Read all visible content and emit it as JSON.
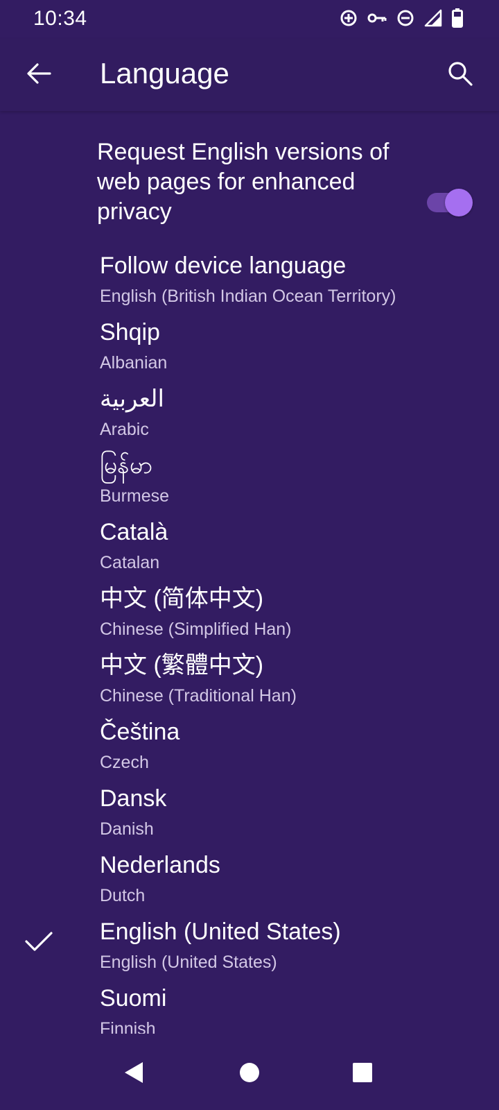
{
  "status_bar": {
    "time": "10:34",
    "icons": [
      "data-saver-icon",
      "vpn-key-icon",
      "do-not-disturb-icon",
      "signal-icon",
      "battery-icon"
    ]
  },
  "app_bar": {
    "title": "Language",
    "back_icon": "arrow-left-icon",
    "search_icon": "search-icon"
  },
  "privacy": {
    "label": "Request English versions of web pages for enhanced privacy",
    "enabled": true
  },
  "languages": [
    {
      "native": "Follow device language",
      "english": "English (British Indian Ocean Territory)",
      "selected": false
    },
    {
      "native": "Shqip",
      "english": "Albanian",
      "selected": false
    },
    {
      "native": "العربية",
      "english": "Arabic",
      "selected": false
    },
    {
      "native": "မြန်မာ",
      "english": "Burmese",
      "selected": false
    },
    {
      "native": "Català",
      "english": "Catalan",
      "selected": false
    },
    {
      "native": "中文 (简体中文)",
      "english": "Chinese (Simplified Han)",
      "selected": false
    },
    {
      "native": "中文 (繁體中文)",
      "english": "Chinese (Traditional Han)",
      "selected": false
    },
    {
      "native": "Čeština",
      "english": "Czech",
      "selected": false
    },
    {
      "native": "Dansk",
      "english": "Danish",
      "selected": false
    },
    {
      "native": "Nederlands",
      "english": "Dutch",
      "selected": false
    },
    {
      "native": "English (United States)",
      "english": "English (United States)",
      "selected": true
    },
    {
      "native": "Suomi",
      "english": "Finnish",
      "selected": false
    }
  ],
  "nav_bar": {
    "back": "nav-back-icon",
    "home": "nav-home-icon",
    "recents": "nav-recents-icon"
  },
  "colors": {
    "background": "#331c62",
    "accent": "#a56ff0",
    "secondary_text": "#d3c8e6"
  }
}
